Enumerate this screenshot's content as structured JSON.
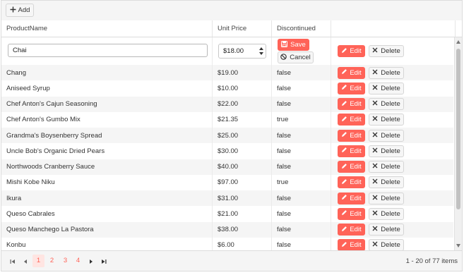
{
  "toolbar": {
    "add_label": "Add"
  },
  "columns": {
    "product_name": "ProductName",
    "unit_price": "Unit Price",
    "discontinued": "Discontinued"
  },
  "edit_row": {
    "product_name_value": "Chai",
    "unit_price_value": "$18.00",
    "save_label": "Save",
    "cancel_label": "Cancel",
    "edit_label": "Edit",
    "delete_label": "Delete"
  },
  "rows": [
    {
      "name": "Chang",
      "price": "$19.00",
      "discontinued": "false"
    },
    {
      "name": "Aniseed Syrup",
      "price": "$10.00",
      "discontinued": "false"
    },
    {
      "name": "Chef Anton's Cajun Seasoning",
      "price": "$22.00",
      "discontinued": "false"
    },
    {
      "name": "Chef Anton's Gumbo Mix",
      "price": "$21.35",
      "discontinued": "true"
    },
    {
      "name": "Grandma's Boysenberry Spread",
      "price": "$25.00",
      "discontinued": "false"
    },
    {
      "name": "Uncle Bob's Organic Dried Pears",
      "price": "$30.00",
      "discontinued": "false"
    },
    {
      "name": "Northwoods Cranberry Sauce",
      "price": "$40.00",
      "discontinued": "false"
    },
    {
      "name": "Mishi Kobe Niku",
      "price": "$97.00",
      "discontinued": "true"
    },
    {
      "name": "Ikura",
      "price": "$31.00",
      "discontinued": "false"
    },
    {
      "name": "Queso Cabrales",
      "price": "$21.00",
      "discontinued": "false"
    },
    {
      "name": "Queso Manchego La Pastora",
      "price": "$38.00",
      "discontinued": "false"
    },
    {
      "name": "Konbu",
      "price": "$6.00",
      "discontinued": "false"
    }
  ],
  "row_actions": {
    "edit_label": "Edit",
    "delete_label": "Delete"
  },
  "pager": {
    "pages": [
      "1",
      "2",
      "3",
      "4"
    ],
    "current_page": "1",
    "info": "1 - 20 of 77 items"
  },
  "colors": {
    "accent": "#ff6358",
    "alt_row": "#f5f5f5"
  }
}
